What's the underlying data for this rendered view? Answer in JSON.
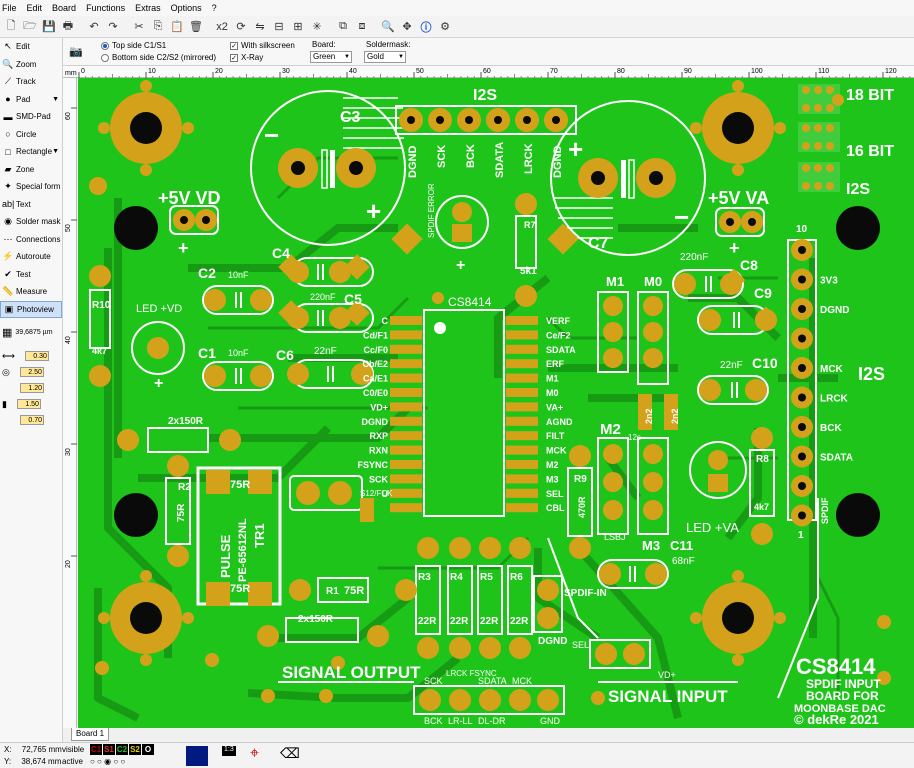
{
  "menu": [
    "File",
    "Edit",
    "Board",
    "Functions",
    "Extras",
    "Options",
    "?"
  ],
  "toolbar_icons": [
    "new-file",
    "open-file",
    "save-file",
    "print",
    "undo",
    "redo",
    "cut",
    "copy",
    "paste",
    "delete",
    "duplicate",
    "rotate",
    "mirror",
    "align",
    "snap",
    "group",
    "lock",
    "unlock",
    "zoom",
    "magnet",
    "info",
    "settings"
  ],
  "toolbar_labels": {
    "duplicate": "x2"
  },
  "tools": [
    {
      "label": "Edit",
      "icon": "↖"
    },
    {
      "label": "Zoom",
      "icon": "🔍"
    },
    {
      "label": "Track",
      "icon": "⟋"
    },
    {
      "label": "Pad",
      "icon": "●",
      "dropdown": true
    },
    {
      "label": "SMD-Pad",
      "icon": "▬"
    },
    {
      "label": "Circle",
      "icon": "○"
    },
    {
      "label": "Rectangle",
      "icon": "□",
      "dropdown": true
    },
    {
      "label": "Zone",
      "icon": "▰"
    },
    {
      "label": "Special form",
      "icon": "✦"
    },
    {
      "label": "Text",
      "icon": "ab|"
    },
    {
      "label": "Solder mask",
      "icon": "◉"
    },
    {
      "label": "Connections",
      "icon": "⋯"
    },
    {
      "label": "Autoroute",
      "icon": "⚡"
    },
    {
      "label": "Test",
      "icon": "✔"
    },
    {
      "label": "Measure",
      "icon": "📏"
    },
    {
      "label": "Photoview",
      "icon": "▣",
      "active": true
    }
  ],
  "grid_value": "39,6875 µm",
  "side_values": {
    "track_width": "0.30",
    "pad_outer": "2.50",
    "pad_inner": "1.20",
    "smd_w": "1.50",
    "smd_h": "0.70"
  },
  "options": {
    "side_top": "Top side C1/S1",
    "side_bottom": "Bottom side C2/S2 (mirrored)",
    "with_silkscreen": "With silkscreen",
    "xray": "X-Ray",
    "board_label": "Board:",
    "board_value": "Green",
    "soldermask_label": "Soldermask:",
    "soldermask_value": "Gold"
  },
  "ruler": {
    "unit": "mm",
    "h_ticks": [
      "0",
      "10",
      "20",
      "30",
      "40",
      "50",
      "60",
      "70",
      "80",
      "90",
      "100",
      "110",
      "120"
    ],
    "v_ticks": [
      "60",
      "50",
      "40",
      "30",
      "20"
    ]
  },
  "board_tab": "Board 1",
  "status": {
    "x_label": "X:",
    "x_value": "72,765 mm",
    "y_label": "Y:",
    "y_value": "38,674 mm",
    "visible_label": "visible",
    "active_label": "active",
    "layers": [
      {
        "name": "C1",
        "color": "#c00000"
      },
      {
        "name": "S1",
        "color": "#e03030"
      },
      {
        "name": "C2",
        "color": "#20c020"
      },
      {
        "name": "S2",
        "color": "#e0d000"
      },
      {
        "name": "O",
        "color": "#ffffff"
      }
    ],
    "scale_value": "1:3"
  },
  "pcb": {
    "colors": {
      "board": "#1fc41a",
      "copper": "#d4a21a",
      "hole": "#0a0a0a",
      "silk": "#ffffff",
      "dark_track": "#179a14"
    },
    "labels": {
      "i2s_top": "I2S",
      "c3": "C3",
      "c7": "C7",
      "vd": "+5V VD",
      "va": "+5V VA",
      "top_pins": [
        "DGND",
        "SCK",
        "BCK",
        "SDATA",
        "LRCK",
        "DGND"
      ],
      "spdif_error": "SPDIF ERROR",
      "r7": "R7",
      "r7_val": "5k1",
      "c4": "C4",
      "c5": "C5",
      "c5_val": "220nF",
      "c2": "C2",
      "c2_val": "10nF",
      "c1": "C1",
      "c1_val": "10nF",
      "c6": "C6",
      "c6_val": "22nF",
      "r10": "R10",
      "r10_val": "4k7",
      "led_vd": "LED +VD",
      "ic": "CS8414",
      "ic_left": [
        "C",
        "Cd/F1",
        "Cc/F0",
        "Cb/E2",
        "Ca/E1",
        "C0/E0",
        "VD+",
        "DGND",
        "RXP",
        "RXN",
        "FSYNC",
        "SCK",
        "U"
      ],
      "ic_right": [
        "VERF",
        "Ce/F2",
        "SDATA",
        "ERF",
        "M1",
        "M0",
        "VA+",
        "AGND",
        "FILT",
        "MCK",
        "M2",
        "M3",
        "SEL",
        "CBL"
      ],
      "m1": "M1",
      "m0": "M0",
      "c8": "C8",
      "c8_val": "220nF",
      "c9": "C9",
      "c10": "C10",
      "c10_val": "22nF",
      "jumpers": [
        "18 BIT",
        "16 BIT",
        "I2S"
      ],
      "conn_pins": [
        "3V3",
        "DGND",
        "MCK",
        "LRCK",
        "BCK",
        "SDATA",
        "SPDIF"
      ],
      "conn_num_top": "10",
      "conn_num_bot": "1",
      "i2s_right": "I2S",
      "r2": "R2",
      "r2_val": "75R",
      "r_top": "2x150R",
      "pulse": "PULSE",
      "pe": "PE-65612NL",
      "tr1": "TR1",
      "tr_75r": "75R",
      "s12": "S12/FCK",
      "r1": "R1",
      "r1_val": "75R",
      "r_bot": "2x150R",
      "m2": "M2",
      "m2_sub": "12s",
      "r9": "R9",
      "r9_val": "470R",
      "lsbj": "LSBJ",
      "m3": "M3",
      "c11": "C11",
      "c11_val": "68nF",
      "r8": "R8",
      "r8_val": "4k7",
      "led_va": "LED +VA",
      "two_n2": "2n2",
      "r3": "R3",
      "r4": "R4",
      "r5": "R5",
      "r6": "R6",
      "r_val": "22R",
      "spdif_in": "SPDIF-IN",
      "dgnd": "DGND",
      "sel": "SEL",
      "vd_plus": "VD+",
      "signal_output": "SIGNAL OUTPUT",
      "signal_input": "SIGNAL INPUT",
      "bot_top": [
        "SCK",
        "LRCK FSYNC",
        "SDATA",
        "MCK"
      ],
      "bot_bot": [
        "BCK",
        "LR-LL",
        "DL-DR",
        "GND"
      ],
      "brand": "CS8414",
      "b1": "SPDIF INPUT",
      "b2": "BOARD FOR",
      "b3": "MOONBASE DAC",
      "b4": "© dekRe 2021",
      "minus": "−",
      "plus": "+"
    }
  }
}
